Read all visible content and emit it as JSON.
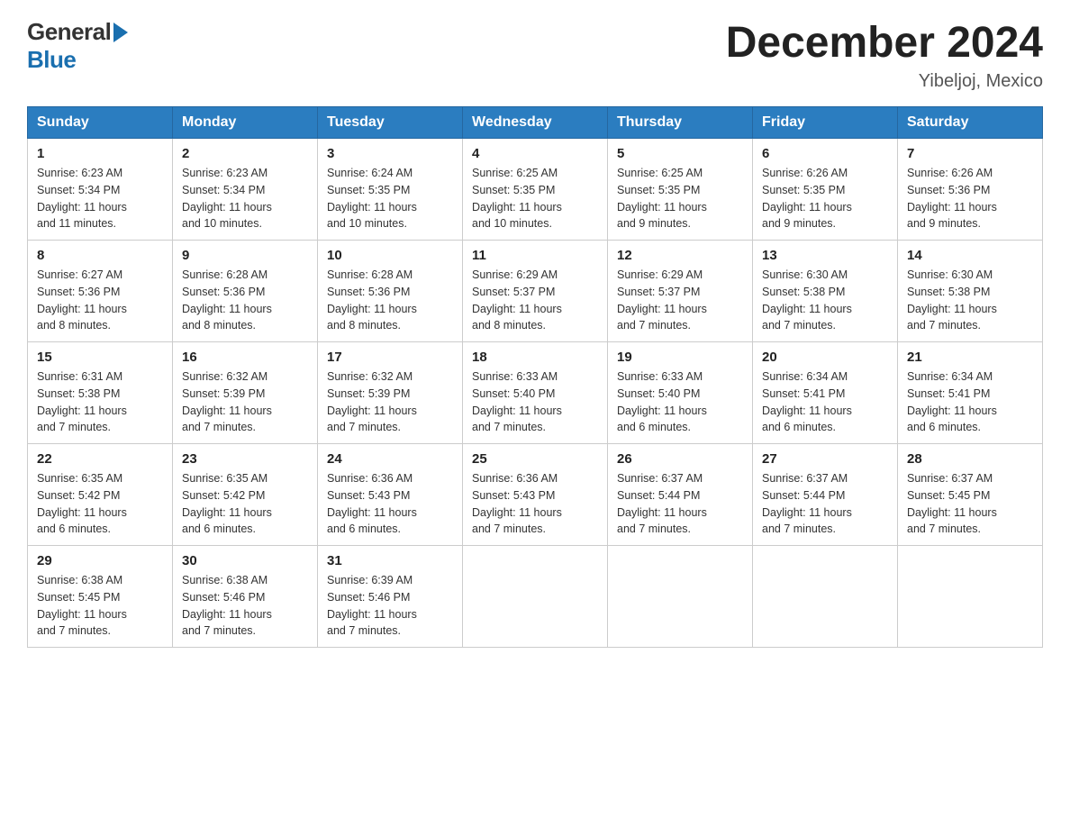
{
  "header": {
    "logo_general": "General",
    "logo_blue": "Blue",
    "title": "December 2024",
    "subtitle": "Yibeljoj, Mexico"
  },
  "calendar": {
    "days_of_week": [
      "Sunday",
      "Monday",
      "Tuesday",
      "Wednesday",
      "Thursday",
      "Friday",
      "Saturday"
    ],
    "weeks": [
      [
        {
          "day": "1",
          "sunrise": "6:23 AM",
          "sunset": "5:34 PM",
          "daylight": "11 hours and 11 minutes."
        },
        {
          "day": "2",
          "sunrise": "6:23 AM",
          "sunset": "5:34 PM",
          "daylight": "11 hours and 10 minutes."
        },
        {
          "day": "3",
          "sunrise": "6:24 AM",
          "sunset": "5:35 PM",
          "daylight": "11 hours and 10 minutes."
        },
        {
          "day": "4",
          "sunrise": "6:25 AM",
          "sunset": "5:35 PM",
          "daylight": "11 hours and 10 minutes."
        },
        {
          "day": "5",
          "sunrise": "6:25 AM",
          "sunset": "5:35 PM",
          "daylight": "11 hours and 9 minutes."
        },
        {
          "day": "6",
          "sunrise": "6:26 AM",
          "sunset": "5:35 PM",
          "daylight": "11 hours and 9 minutes."
        },
        {
          "day": "7",
          "sunrise": "6:26 AM",
          "sunset": "5:36 PM",
          "daylight": "11 hours and 9 minutes."
        }
      ],
      [
        {
          "day": "8",
          "sunrise": "6:27 AM",
          "sunset": "5:36 PM",
          "daylight": "11 hours and 8 minutes."
        },
        {
          "day": "9",
          "sunrise": "6:28 AM",
          "sunset": "5:36 PM",
          "daylight": "11 hours and 8 minutes."
        },
        {
          "day": "10",
          "sunrise": "6:28 AM",
          "sunset": "5:36 PM",
          "daylight": "11 hours and 8 minutes."
        },
        {
          "day": "11",
          "sunrise": "6:29 AM",
          "sunset": "5:37 PM",
          "daylight": "11 hours and 8 minutes."
        },
        {
          "day": "12",
          "sunrise": "6:29 AM",
          "sunset": "5:37 PM",
          "daylight": "11 hours and 7 minutes."
        },
        {
          "day": "13",
          "sunrise": "6:30 AM",
          "sunset": "5:38 PM",
          "daylight": "11 hours and 7 minutes."
        },
        {
          "day": "14",
          "sunrise": "6:30 AM",
          "sunset": "5:38 PM",
          "daylight": "11 hours and 7 minutes."
        }
      ],
      [
        {
          "day": "15",
          "sunrise": "6:31 AM",
          "sunset": "5:38 PM",
          "daylight": "11 hours and 7 minutes."
        },
        {
          "day": "16",
          "sunrise": "6:32 AM",
          "sunset": "5:39 PM",
          "daylight": "11 hours and 7 minutes."
        },
        {
          "day": "17",
          "sunrise": "6:32 AM",
          "sunset": "5:39 PM",
          "daylight": "11 hours and 7 minutes."
        },
        {
          "day": "18",
          "sunrise": "6:33 AM",
          "sunset": "5:40 PM",
          "daylight": "11 hours and 7 minutes."
        },
        {
          "day": "19",
          "sunrise": "6:33 AM",
          "sunset": "5:40 PM",
          "daylight": "11 hours and 6 minutes."
        },
        {
          "day": "20",
          "sunrise": "6:34 AM",
          "sunset": "5:41 PM",
          "daylight": "11 hours and 6 minutes."
        },
        {
          "day": "21",
          "sunrise": "6:34 AM",
          "sunset": "5:41 PM",
          "daylight": "11 hours and 6 minutes."
        }
      ],
      [
        {
          "day": "22",
          "sunrise": "6:35 AM",
          "sunset": "5:42 PM",
          "daylight": "11 hours and 6 minutes."
        },
        {
          "day": "23",
          "sunrise": "6:35 AM",
          "sunset": "5:42 PM",
          "daylight": "11 hours and 6 minutes."
        },
        {
          "day": "24",
          "sunrise": "6:36 AM",
          "sunset": "5:43 PM",
          "daylight": "11 hours and 6 minutes."
        },
        {
          "day": "25",
          "sunrise": "6:36 AM",
          "sunset": "5:43 PM",
          "daylight": "11 hours and 7 minutes."
        },
        {
          "day": "26",
          "sunrise": "6:37 AM",
          "sunset": "5:44 PM",
          "daylight": "11 hours and 7 minutes."
        },
        {
          "day": "27",
          "sunrise": "6:37 AM",
          "sunset": "5:44 PM",
          "daylight": "11 hours and 7 minutes."
        },
        {
          "day": "28",
          "sunrise": "6:37 AM",
          "sunset": "5:45 PM",
          "daylight": "11 hours and 7 minutes."
        }
      ],
      [
        {
          "day": "29",
          "sunrise": "6:38 AM",
          "sunset": "5:45 PM",
          "daylight": "11 hours and 7 minutes."
        },
        {
          "day": "30",
          "sunrise": "6:38 AM",
          "sunset": "5:46 PM",
          "daylight": "11 hours and 7 minutes."
        },
        {
          "day": "31",
          "sunrise": "6:39 AM",
          "sunset": "5:46 PM",
          "daylight": "11 hours and 7 minutes."
        },
        null,
        null,
        null,
        null
      ]
    ],
    "labels": {
      "sunrise": "Sunrise:",
      "sunset": "Sunset:",
      "daylight": "Daylight:"
    }
  }
}
